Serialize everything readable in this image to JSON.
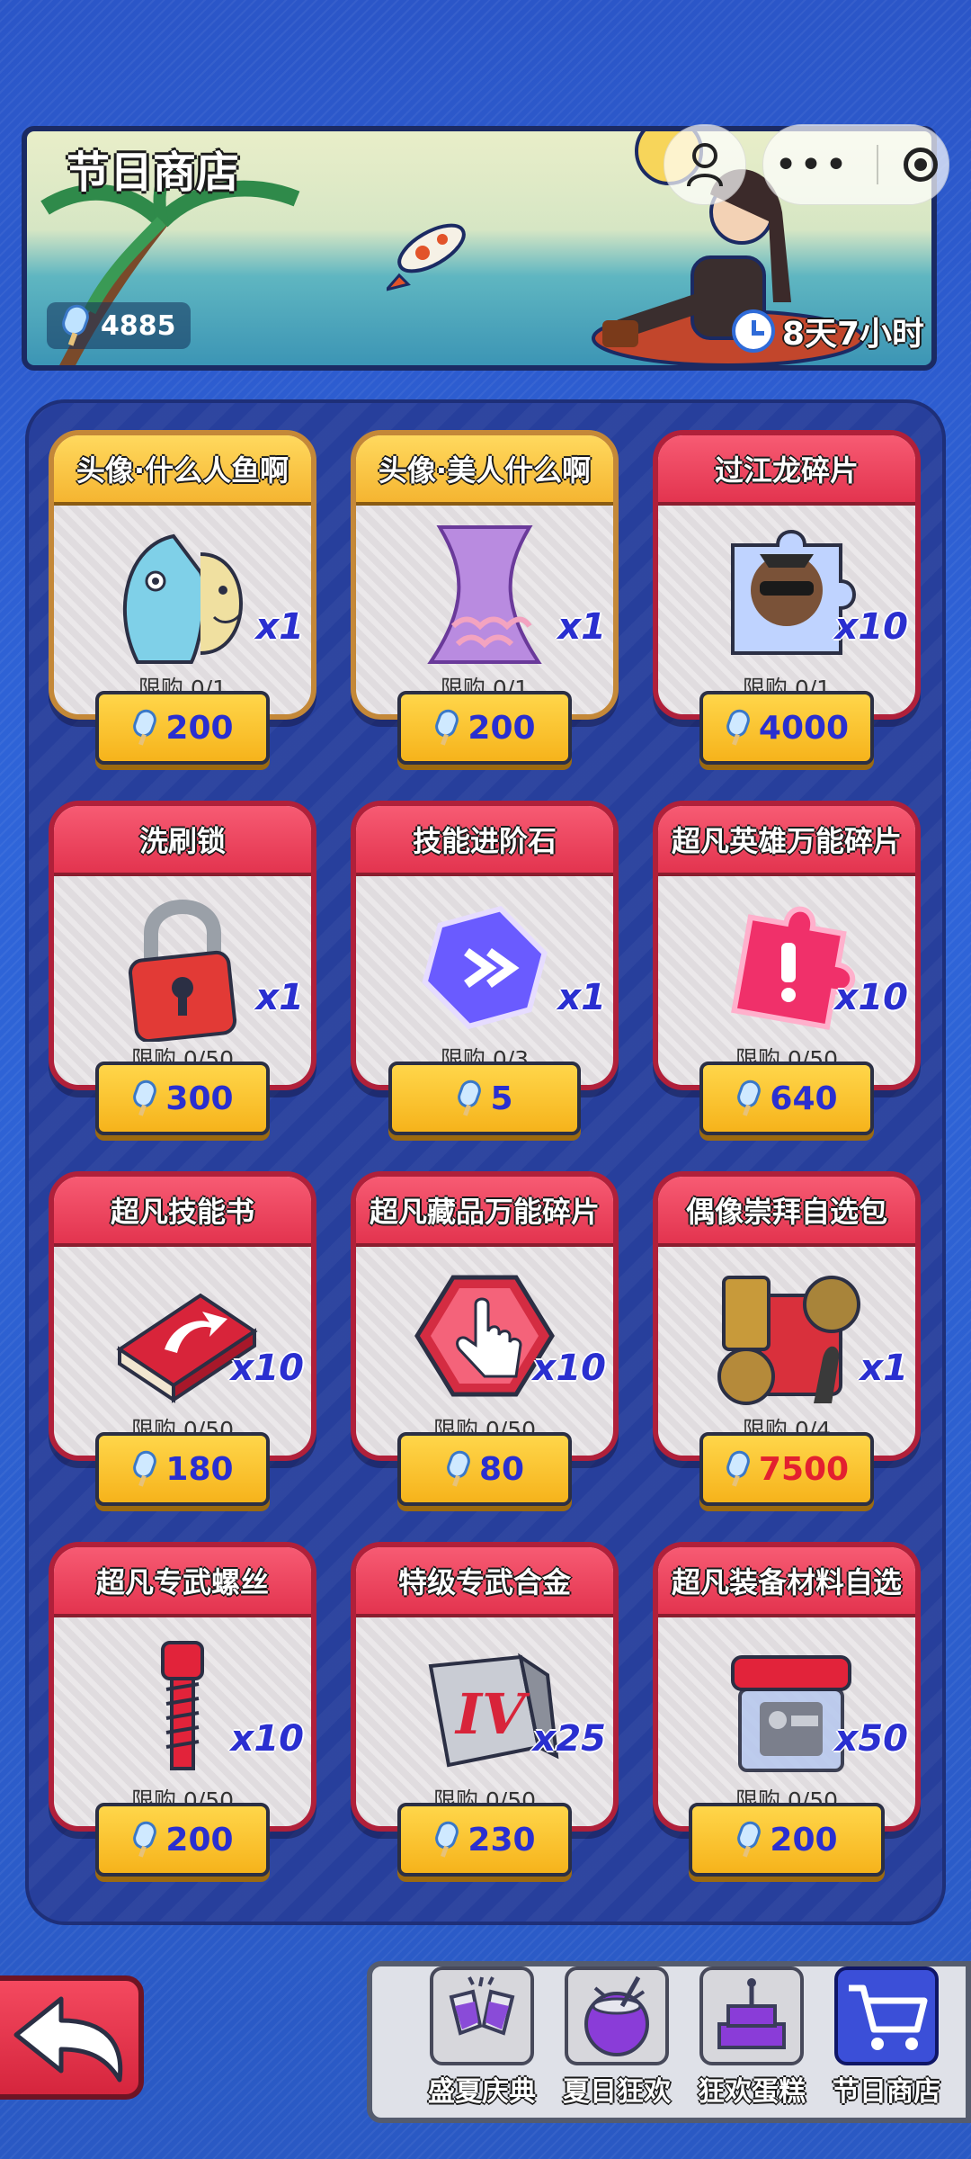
{
  "header": {
    "title": "节日商店",
    "currency_amount": "4885",
    "timer": "8天7小时"
  },
  "colors": {
    "card_red": "#e3344f",
    "card_gold": "#f5b531",
    "price_blue": "#2a2fd0",
    "price_red": "#e3202f",
    "background": "#2f65d9"
  },
  "items": [
    {
      "name": "头像·什么人鱼啊",
      "qty": "x1",
      "limit": "限购 0/1",
      "price": "200",
      "theme": "gold",
      "icon": "fish-avatar-icon"
    },
    {
      "name": "头像·美人什么啊",
      "qty": "x1",
      "limit": "限购 0/1",
      "price": "200",
      "theme": "gold",
      "icon": "mermaid-tail-icon"
    },
    {
      "name": "过江龙碎片",
      "qty": "x10",
      "limit": "限购 0/1",
      "price": "4000",
      "theme": "red",
      "icon": "hero-puzzle-icon"
    },
    {
      "name": "洗刷锁",
      "qty": "x1",
      "limit": "限购 0/50",
      "price": "300",
      "theme": "red",
      "icon": "padlock-icon"
    },
    {
      "name": "技能进阶石",
      "qty": "x1",
      "limit": "限购 0/3",
      "price": "5",
      "theme": "red",
      "icon": "skill-stone-icon"
    },
    {
      "name": "超凡英雄万能碎片",
      "qty": "x10",
      "limit": "限购 0/50",
      "price": "640",
      "theme": "red",
      "icon": "universal-puzzle-icon"
    },
    {
      "name": "超凡技能书",
      "qty": "x10",
      "limit": "限购 0/50",
      "price": "180",
      "theme": "red",
      "icon": "skill-book-icon"
    },
    {
      "name": "超凡藏品万能碎片",
      "qty": "x10",
      "limit": "限购 0/50",
      "price": "80",
      "theme": "red",
      "icon": "hand-hexagon-icon"
    },
    {
      "name": "偶像崇拜自选包",
      "qty": "x1",
      "limit": "限购 0/4",
      "price": "7500",
      "theme": "red",
      "icon": "relic-pack-icon"
    },
    {
      "name": "超凡专武螺丝",
      "qty": "x10",
      "limit": "限购 0/50",
      "price": "200",
      "theme": "red",
      "icon": "screw-icon"
    },
    {
      "name": "特级专武合金",
      "qty": "x25",
      "limit": "限购 0/50",
      "price": "230",
      "theme": "red",
      "icon": "alloy-iv-icon"
    },
    {
      "name": "超凡装备材料自选",
      "qty": "x50",
      "limit": "限购 0/50",
      "price": "200",
      "theme": "red",
      "icon": "material-box-icon"
    }
  ],
  "tabs": [
    {
      "label": "盛夏庆典",
      "icon": "cheers-icon"
    },
    {
      "label": "夏日狂欢",
      "icon": "coconut-drink-icon"
    },
    {
      "label": "狂欢蛋糕",
      "icon": "cake-icon"
    },
    {
      "label": "节日商店",
      "icon": "cart-icon"
    }
  ]
}
